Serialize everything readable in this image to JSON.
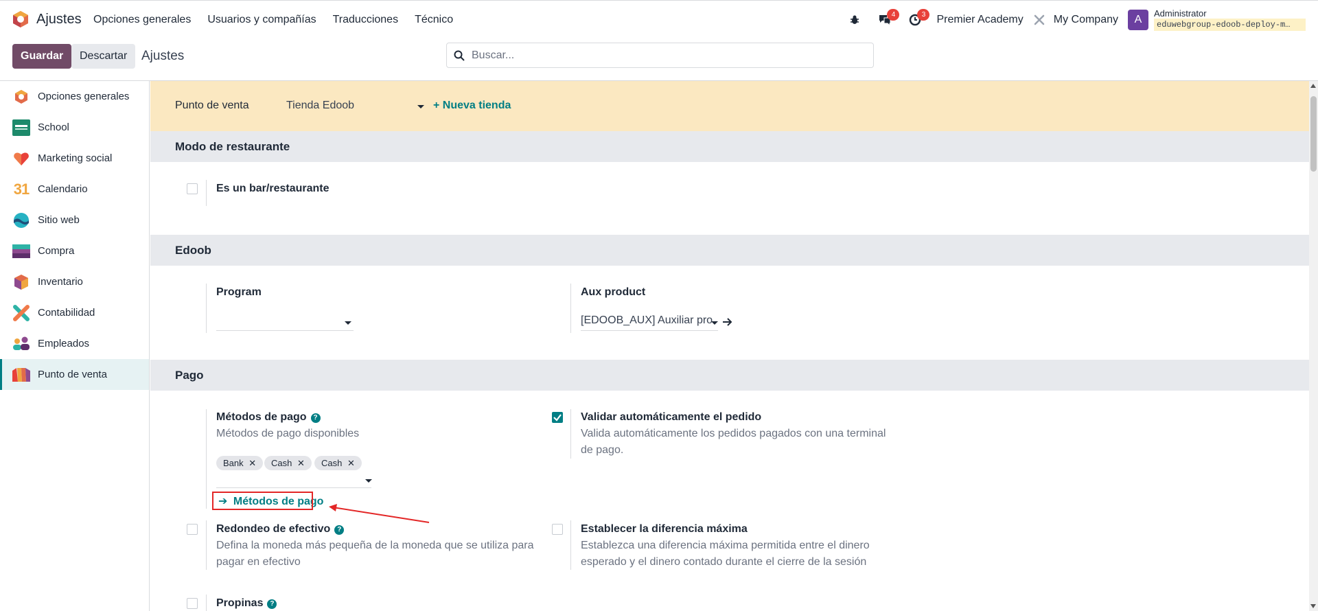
{
  "navbar": {
    "app_name": "Ajustes",
    "menu": [
      "Opciones generales",
      "Usuarios y compañías",
      "Traducciones",
      "Técnico"
    ],
    "messages_count": "4",
    "activities_count": "3",
    "company_school": "Premier Academy",
    "company_name": "My Company",
    "avatar_letter": "A",
    "user_name": "Administrator",
    "db_name": "eduwebgroup-edoob-deploy-m…"
  },
  "control": {
    "save_label": "Guardar",
    "discard_label": "Descartar",
    "breadcrumb": "Ajustes",
    "search_placeholder": "Buscar..."
  },
  "sidebar": {
    "items": [
      {
        "label": "Opciones generales",
        "icon": "settings-app-icon"
      },
      {
        "label": "School",
        "icon": "school-app-icon"
      },
      {
        "label": "Marketing social",
        "icon": "heart-app-icon"
      },
      {
        "label": "Calendario",
        "icon": "calendar-app-icon"
      },
      {
        "label": "Sitio web",
        "icon": "website-app-icon"
      },
      {
        "label": "Compra",
        "icon": "purchase-app-icon"
      },
      {
        "label": "Inventario",
        "icon": "inventory-app-icon"
      },
      {
        "label": "Contabilidad",
        "icon": "accounting-app-icon"
      },
      {
        "label": "Empleados",
        "icon": "employees-app-icon"
      },
      {
        "label": "Punto de venta",
        "icon": "pos-app-icon"
      }
    ],
    "active_index": 9
  },
  "pos": {
    "label": "Punto de venta",
    "shop": "Tienda Edoob",
    "new_shop": "+ Nueva tienda"
  },
  "restaurant": {
    "title": "Modo de restaurante",
    "is_bar_label": "Es un bar/restaurante",
    "is_bar_checked": false
  },
  "edoob": {
    "title": "Edoob",
    "program_label": "Program",
    "program_value": "",
    "aux_label": "Aux product",
    "aux_value": "[EDOOB_AUX] Auxiliar pro"
  },
  "payment": {
    "title": "Pago",
    "methods_label": "Métodos de pago",
    "methods_desc": "Métodos de pago disponibles",
    "tags": [
      "Bank",
      "Cash",
      "Cash"
    ],
    "methods_link": "Métodos de pago",
    "validate_label": "Validar automáticamente el pedido",
    "validate_desc": "Valida automáticamente los pedidos pagados con una terminal de pago.",
    "validate_checked": true,
    "rounding_label": "Redondeo de efectivo",
    "rounding_desc": "Defina la moneda más pequeña de la moneda que se utiliza para pagar en efectivo",
    "rounding_checked": false,
    "max_diff_label": "Establecer la diferencia máxima",
    "max_diff_desc": "Establezca una diferencia máxima permitida entre el dinero esperado y el dinero contado durante el cierre de la sesión",
    "max_diff_checked": false,
    "tips_label": "Propinas",
    "tips_checked": false
  },
  "colors": {
    "brand": "#714b67",
    "accent": "#017e84",
    "badge": "#e8413a",
    "annotation": "#e32626"
  }
}
